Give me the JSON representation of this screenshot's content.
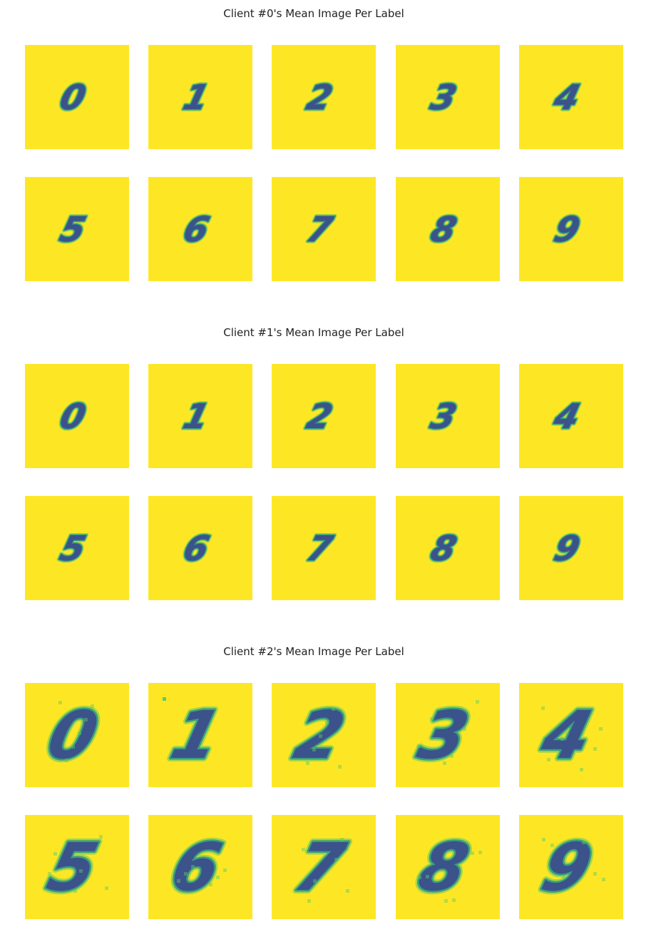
{
  "colors": {
    "background": "#fde725",
    "stroke_dark": "#3b528b",
    "stroke_mid": "#21918c",
    "stroke_light": "#5ec962"
  },
  "colormap": "viridis",
  "chart_data": [
    {
      "type": "heatmap",
      "title": "Client #0's Mean Image Per Label",
      "panels": [
        "0",
        "1",
        "2",
        "3",
        "4",
        "5",
        "6",
        "7",
        "8",
        "9"
      ],
      "digit_scale": "small",
      "spread": "low"
    },
    {
      "type": "heatmap",
      "title": "Client #1's Mean Image Per Label",
      "panels": [
        "0",
        "1",
        "2",
        "3",
        "4",
        "5",
        "6",
        "7",
        "8",
        "9"
      ],
      "digit_scale": "small",
      "spread": "low"
    },
    {
      "type": "heatmap",
      "title": "Client #2's Mean Image Per Label",
      "panels": [
        "0",
        "1",
        "2",
        "3",
        "4",
        "5",
        "6",
        "7",
        "8",
        "9"
      ],
      "digit_scale": "large",
      "spread": "high"
    }
  ]
}
